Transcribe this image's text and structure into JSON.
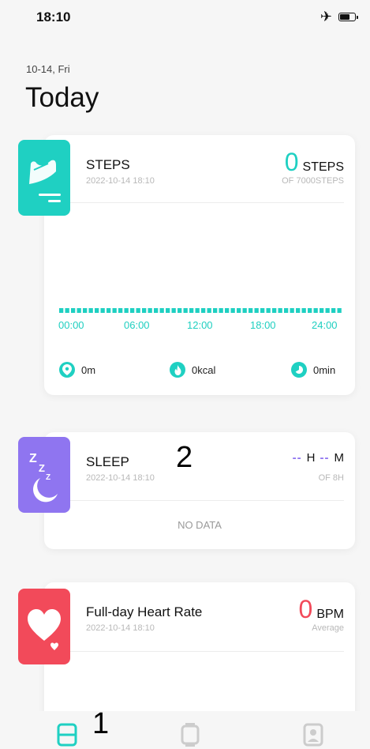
{
  "status": {
    "time": "18:10",
    "airplane_icon": "airplane-icon",
    "battery_icon": "battery-icon",
    "battery_level": 0.6
  },
  "header": {
    "date": "10-14, Fri",
    "title": "Today"
  },
  "steps": {
    "title": "STEPS",
    "timestamp": "2022-10-14 18:10",
    "value": "0",
    "unit": "STEPS",
    "goal": "OF 7000STEPS",
    "hours": [
      "00:00",
      "06:00",
      "12:00",
      "18:00",
      "24:00"
    ],
    "distance": "0m",
    "calories": "0kcal",
    "duration": "0min",
    "accent": "#1fd0c2"
  },
  "sleep": {
    "title": "SLEEP",
    "timestamp": "2022-10-14 18:10",
    "hours_value": "--",
    "hours_unit": "H",
    "minutes_value": "--",
    "minutes_unit": "M",
    "goal": "OF 8H",
    "empty_text": "NO DATA",
    "accent": "#8f75f0"
  },
  "heart": {
    "title": "Full-day Heart Rate",
    "timestamp": "2022-10-14 18:10",
    "value": "0",
    "unit": "BPM",
    "subtext": "Average",
    "accent": "#f24a5a"
  },
  "annotations": {
    "one": "1",
    "two": "2"
  },
  "tabs": [
    "tab-today",
    "tab-device",
    "tab-profile"
  ]
}
